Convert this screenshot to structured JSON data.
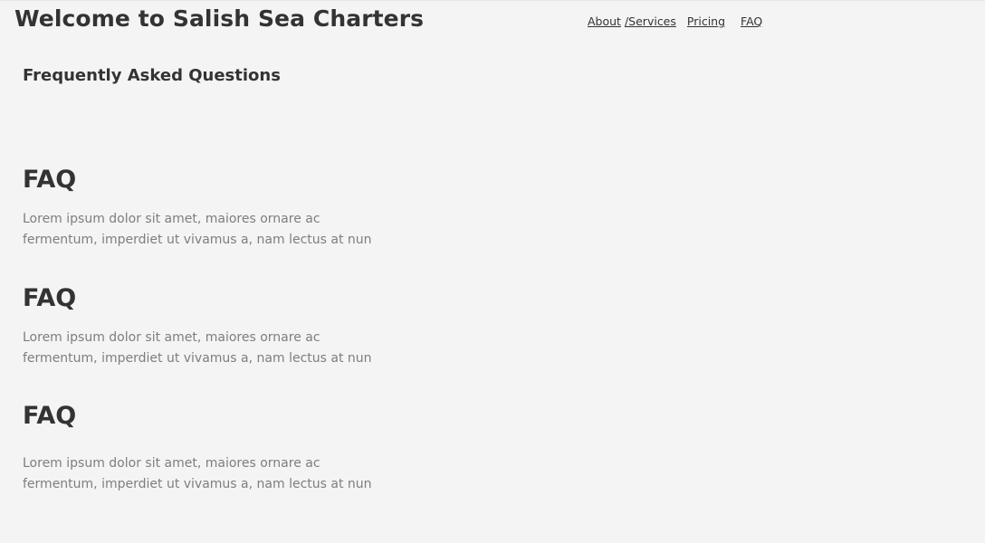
{
  "header": {
    "title": "Welcome to Salish Sea Charters",
    "nav": {
      "about": "About",
      "services": "/Services",
      "pricing": "Pricing",
      "faq": "FAQ"
    }
  },
  "main": {
    "subheading": "Frequently Asked Questions",
    "faqs": [
      {
        "title": "FAQ",
        "text": "Lorem ipsum dolor sit amet, maiores ornare ac fermentum, imperdiet ut vivamus a, nam lectus at nun"
      },
      {
        "title": "FAQ",
        "text": "Lorem ipsum dolor sit amet, maiores ornare ac fermentum, imperdiet ut vivamus a, nam lectus at nun"
      },
      {
        "title": "FAQ",
        "text": "Lorem ipsum dolor sit amet, maiores ornare ac fermentum, imperdiet ut vivamus a, nam lectus at nun"
      }
    ]
  },
  "colors": {
    "background": "#f4f4f4",
    "heading": "#333333",
    "body_text": "#7e7e7e"
  }
}
